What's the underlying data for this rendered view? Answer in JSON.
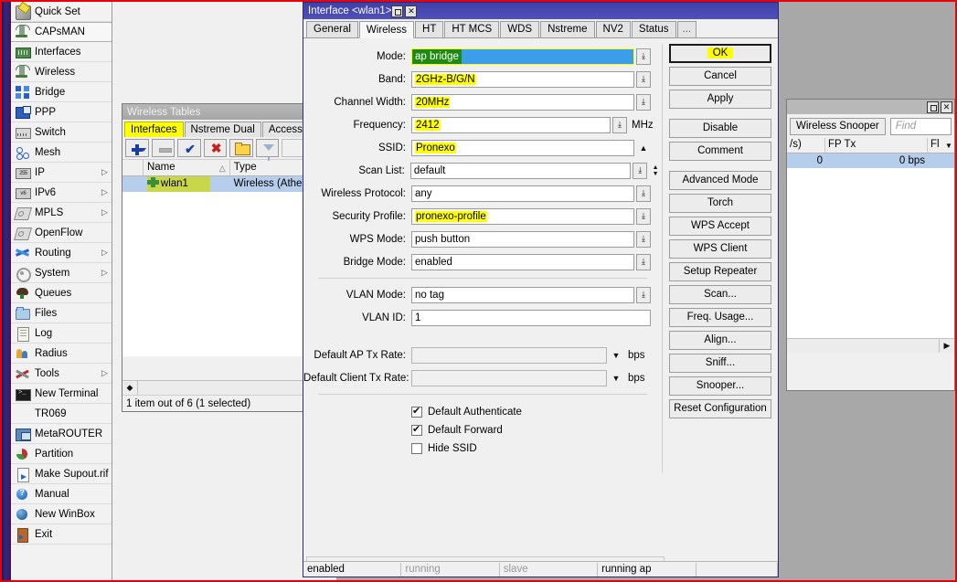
{
  "window": {
    "dialog_title": "Interface <wlan1>",
    "wireless_tables_title": "Wireless Tables",
    "maximize_glyph": "□",
    "close_glyph": "✕"
  },
  "sidebar": {
    "items": [
      {
        "label": "Quick Set",
        "icon": "quickset-icon",
        "arrow": "",
        "hovered": false
      },
      {
        "label": "CAPsMAN",
        "icon": "antenna-icon",
        "arrow": "",
        "hovered": true
      },
      {
        "label": "Interfaces",
        "icon": "interfaces-icon",
        "arrow": "",
        "hovered": false
      },
      {
        "label": "Wireless",
        "icon": "antenna-icon",
        "arrow": "",
        "hovered": false
      },
      {
        "label": "Bridge",
        "icon": "bridge-icon",
        "arrow": "",
        "hovered": false
      },
      {
        "label": "PPP",
        "icon": "ppp-icon",
        "arrow": "",
        "hovered": false
      },
      {
        "label": "Switch",
        "icon": "switch-icon",
        "arrow": "",
        "hovered": false
      },
      {
        "label": "Mesh",
        "icon": "mesh-icon",
        "arrow": "",
        "hovered": false
      },
      {
        "label": "IP",
        "icon": "ip-icon",
        "arrow": "▷",
        "hovered": false
      },
      {
        "label": "IPv6",
        "icon": "ipv6-icon",
        "arrow": "▷",
        "hovered": false
      },
      {
        "label": "MPLS",
        "icon": "tag-icon",
        "arrow": "▷",
        "hovered": false
      },
      {
        "label": "OpenFlow",
        "icon": "tag-icon",
        "arrow": "",
        "hovered": false
      },
      {
        "label": "Routing",
        "icon": "routing-icon",
        "arrow": "▷",
        "hovered": false
      },
      {
        "label": "System",
        "icon": "gear-icon",
        "arrow": "▷",
        "hovered": false
      },
      {
        "label": "Queues",
        "icon": "queues-icon",
        "arrow": "",
        "hovered": false
      },
      {
        "label": "Files",
        "icon": "files-icon",
        "arrow": "",
        "hovered": false
      },
      {
        "label": "Log",
        "icon": "log-icon",
        "arrow": "",
        "hovered": false
      },
      {
        "label": "Radius",
        "icon": "radius-icon",
        "arrow": "",
        "hovered": false
      },
      {
        "label": "Tools",
        "icon": "tools-icon",
        "arrow": "▷",
        "hovered": false
      },
      {
        "label": "New Terminal",
        "icon": "terminal-icon",
        "arrow": "",
        "hovered": false
      },
      {
        "label": "TR069",
        "icon": "",
        "arrow": "",
        "hovered": false
      },
      {
        "label": "MetaROUTER",
        "icon": "metarouter-icon",
        "arrow": "",
        "hovered": false
      },
      {
        "label": "Partition",
        "icon": "partition-icon",
        "arrow": "",
        "hovered": false
      },
      {
        "label": "Make Supout.rif",
        "icon": "supout-icon",
        "arrow": "",
        "hovered": false
      },
      {
        "label": "Manual",
        "icon": "manual-icon",
        "arrow": "",
        "hovered": false
      },
      {
        "label": "New WinBox",
        "icon": "newwinbox-icon",
        "arrow": "",
        "hovered": false
      },
      {
        "label": "Exit",
        "icon": "exit-icon",
        "arrow": "",
        "hovered": false
      }
    ]
  },
  "wireless_tables": {
    "title": "Wireless Tables",
    "tabs": [
      {
        "label": "Interfaces",
        "highlighted": true
      },
      {
        "label": "Nstreme Dual",
        "highlighted": false
      },
      {
        "label": "Access List",
        "highlighted": false
      }
    ],
    "toolbar": [
      {
        "name": "add-button",
        "icon": "plus-icon"
      },
      {
        "name": "remove-button",
        "icon": "minus-icon"
      },
      {
        "name": "enable-button",
        "icon": "check-icon"
      },
      {
        "name": "disable-button",
        "icon": "cross-icon"
      },
      {
        "name": "comment-button",
        "icon": "folder-icon"
      },
      {
        "name": "filter-button",
        "icon": "funnel-icon"
      }
    ],
    "columns": [
      "",
      "Name",
      "Type"
    ],
    "sort_glyph": "△",
    "rows": [
      {
        "name": "wlan1",
        "type": "Wireless (Athe",
        "selected": true,
        "highlighted": true
      }
    ],
    "status": "1 item out of 6 (1 selected)",
    "scroll_arrow": "◆"
  },
  "snooper_panel": {
    "buttons": [
      "Wireless Snooper"
    ],
    "find_placeholder": "Find",
    "columns": [
      "/s)",
      "FP Tx",
      "Fl"
    ],
    "rows": [
      {
        "rate": "0",
        "fp_tx": "0 bps",
        "fl": ""
      }
    ],
    "dropdown_glyph": "▼",
    "scroll_arrow": "▶"
  },
  "dialog": {
    "title": "Interface <wlan1>",
    "tabs": [
      {
        "label": "General",
        "active": false
      },
      {
        "label": "Wireless",
        "active": true
      },
      {
        "label": "HT",
        "active": false
      },
      {
        "label": "HT MCS",
        "active": false
      },
      {
        "label": "WDS",
        "active": false
      },
      {
        "label": "Nstreme",
        "active": false
      },
      {
        "label": "NV2",
        "active": false
      },
      {
        "label": "Status",
        "active": false
      },
      {
        "label": "...",
        "active": false
      }
    ],
    "fields": [
      {
        "label": "Mode:",
        "value": "ap bridge",
        "control": "mode-select",
        "highlight": "mode",
        "unit": ""
      },
      {
        "label": "Band:",
        "value": "2GHz-B/G/N",
        "control": "dropdown",
        "highlight": "yellow",
        "unit": ""
      },
      {
        "label": "Channel Width:",
        "value": "20MHz",
        "control": "dropdown",
        "highlight": "yellow",
        "unit": ""
      },
      {
        "label": "Frequency:",
        "value": "2412",
        "control": "dropdown",
        "highlight": "yellow",
        "unit": "MHz"
      },
      {
        "label": "SSID:",
        "value": "Pronexo",
        "control": "uparrow",
        "highlight": "yellow",
        "unit": ""
      },
      {
        "label": "Scan List:",
        "value": "default",
        "control": "dropdown-spin",
        "highlight": "none",
        "unit": ""
      },
      {
        "label": "Wireless Protocol:",
        "value": "any",
        "control": "dropdown",
        "highlight": "none",
        "unit": ""
      },
      {
        "label": "Security Profile:",
        "value": "pronexo-profile",
        "control": "dropdown",
        "highlight": "yellow",
        "unit": ""
      },
      {
        "label": "WPS Mode:",
        "value": "push button",
        "control": "dropdown",
        "highlight": "none",
        "unit": ""
      },
      {
        "label": "Bridge Mode:",
        "value": "enabled",
        "control": "dropdown",
        "highlight": "none",
        "unit": ""
      }
    ],
    "vlan_fields": [
      {
        "label": "VLAN Mode:",
        "value": "no tag",
        "control": "dropdown",
        "unit": ""
      },
      {
        "label": "VLAN ID:",
        "value": "1",
        "control": "none",
        "unit": ""
      }
    ],
    "rate_fields": [
      {
        "label": "Default AP Tx Rate:",
        "value": "",
        "control": "caret",
        "unit": "bps"
      },
      {
        "label": "Default Client Tx Rate:",
        "value": "",
        "control": "caret",
        "unit": "bps"
      }
    ],
    "checkboxes": [
      {
        "label": "Default Authenticate",
        "checked": true
      },
      {
        "label": "Default Forward",
        "checked": true
      },
      {
        "label": "Hide SSID",
        "checked": false
      }
    ],
    "buttons": [
      {
        "label": "OK",
        "default": true,
        "highlighted": true,
        "gap_after": false
      },
      {
        "label": "Cancel",
        "default": false,
        "highlighted": false,
        "gap_after": false
      },
      {
        "label": "Apply",
        "default": false,
        "highlighted": false,
        "gap_after": true
      },
      {
        "label": "Disable",
        "default": false,
        "highlighted": false,
        "gap_after": false
      },
      {
        "label": "Comment",
        "default": false,
        "highlighted": false,
        "gap_after": true
      },
      {
        "label": "Advanced Mode",
        "default": false,
        "highlighted": false,
        "gap_after": false
      },
      {
        "label": "Torch",
        "default": false,
        "highlighted": false,
        "gap_after": false
      },
      {
        "label": "WPS Accept",
        "default": false,
        "highlighted": false,
        "gap_after": false
      },
      {
        "label": "WPS Client",
        "default": false,
        "highlighted": false,
        "gap_after": false
      },
      {
        "label": "Setup Repeater",
        "default": false,
        "highlighted": false,
        "gap_after": false
      },
      {
        "label": "Scan...",
        "default": false,
        "highlighted": false,
        "gap_after": false
      },
      {
        "label": "Freq. Usage...",
        "default": false,
        "highlighted": false,
        "gap_after": false
      },
      {
        "label": "Align...",
        "default": false,
        "highlighted": false,
        "gap_after": false
      },
      {
        "label": "Sniff...",
        "default": false,
        "highlighted": false,
        "gap_after": false
      },
      {
        "label": "Snooper...",
        "default": false,
        "highlighted": false,
        "gap_after": false
      },
      {
        "label": "Reset Configuration",
        "default": false,
        "highlighted": false,
        "gap_after": false
      }
    ],
    "status_cells": [
      {
        "text": "enabled",
        "dim": false
      },
      {
        "text": "running",
        "dim": true
      },
      {
        "text": "slave",
        "dim": true
      },
      {
        "text": "running ap",
        "dim": false
      },
      {
        "text": "",
        "dim": false
      }
    ],
    "glyphs": {
      "dropdown": "⤓",
      "up_arrow": "▲",
      "spin_up": "▲",
      "spin_down": "▼",
      "caret_down": "▼"
    }
  },
  "colors": {
    "highlight_yellow": "#ffff00",
    "mode_green": "#1f8a12",
    "mode_blue": "#3a9fe8",
    "selection_blue": "#b6cdeb",
    "titlebar_blue": "#4040a8",
    "red_border": "#e8000b"
  }
}
